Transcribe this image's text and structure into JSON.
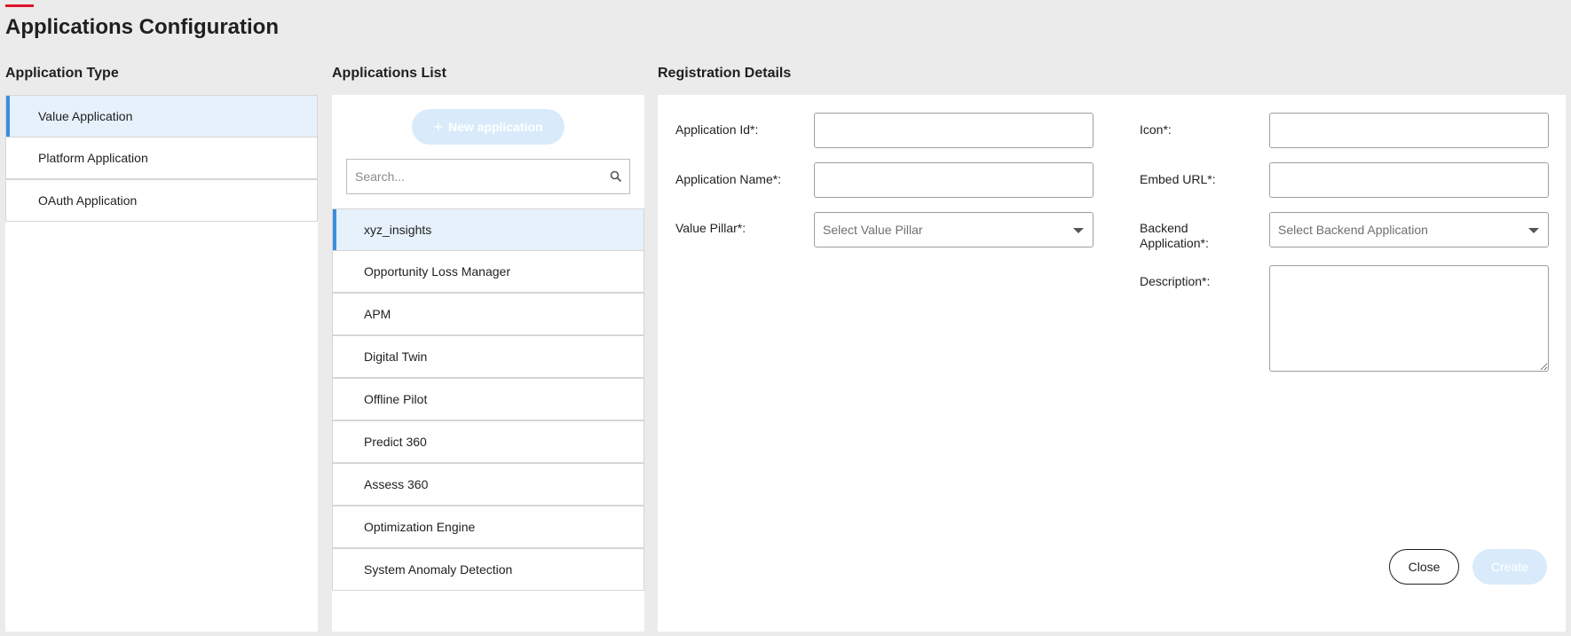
{
  "page": {
    "title": "Applications Configuration"
  },
  "colors": {
    "accent": "#e0162b",
    "selection": "#3b8ee0",
    "selection_bg": "#e6f1fb",
    "disabled_button": "#d9ebfa"
  },
  "application_type": {
    "heading": "Application Type",
    "items": [
      {
        "label": "Value Application",
        "selected": true
      },
      {
        "label": "Platform Application",
        "selected": false
      },
      {
        "label": "OAuth Application",
        "selected": false
      }
    ]
  },
  "applications_list": {
    "heading": "Applications List",
    "new_button_label": "New application",
    "new_button_icon": "plus-icon",
    "search_placeholder": "Search...",
    "search_icon": "search-icon",
    "items": [
      {
        "label": "xyz_insights",
        "selected": true
      },
      {
        "label": "Opportunity Loss Manager",
        "selected": false
      },
      {
        "label": "APM",
        "selected": false
      },
      {
        "label": "Digital Twin",
        "selected": false
      },
      {
        "label": "Offline Pilot",
        "selected": false
      },
      {
        "label": "Predict 360",
        "selected": false
      },
      {
        "label": "Assess 360",
        "selected": false
      },
      {
        "label": "Optimization Engine",
        "selected": false
      },
      {
        "label": "System Anomaly Detection",
        "selected": false
      }
    ]
  },
  "registration": {
    "heading": "Registration Details",
    "application_id_label": "Application Id*:",
    "application_id_value": "",
    "application_name_label": "Application Name*:",
    "application_name_value": "",
    "value_pillar_label": "Value Pillar*:",
    "value_pillar_placeholder": "Select Value Pillar",
    "icon_label": "Icon*:",
    "icon_value": "",
    "embed_url_label": "Embed URL*:",
    "embed_url_value": "",
    "backend_label_line1": "Backend",
    "backend_label_line2": "Application*:",
    "backend_placeholder": "Select Backend Application",
    "description_label": "Description*:",
    "description_value": "",
    "close_label": "Close",
    "create_label": "Create"
  }
}
